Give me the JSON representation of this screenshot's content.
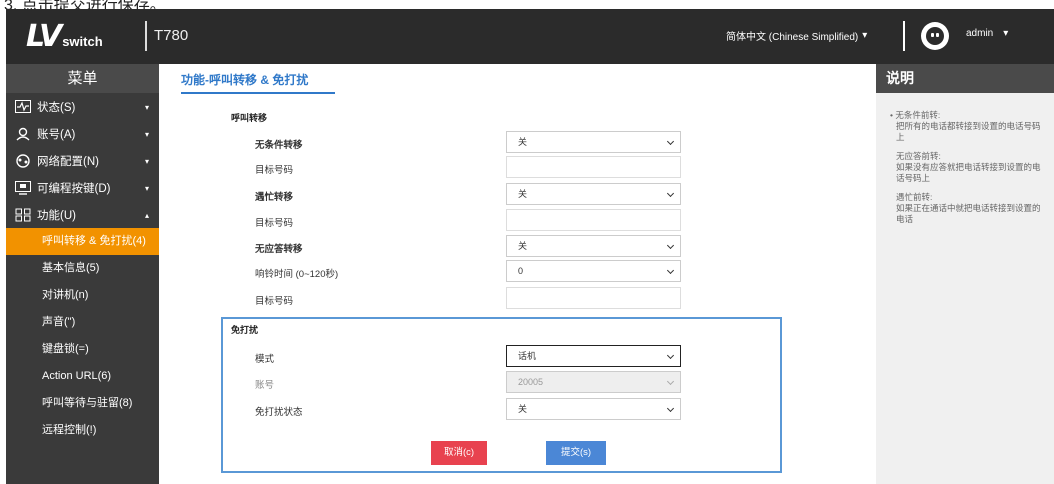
{
  "caption": "3. 点击提交进行保存。",
  "topbar": {
    "logo_mark": "LV",
    "logo_sub": "switch",
    "model": "T780",
    "language": "简体中文 (Chinese Simplified)",
    "language_caret": "▾",
    "user": "admin",
    "user_caret": "▾"
  },
  "sidebar": {
    "title": "菜单",
    "items": [
      {
        "label": "状态(S)",
        "icon": "status-icon",
        "caret": "▾"
      },
      {
        "label": "账号(A)",
        "icon": "account-icon",
        "caret": "▾"
      },
      {
        "label": "网络配置(N)",
        "icon": "network-icon",
        "caret": "▾"
      },
      {
        "label": "可编程按键(D)",
        "icon": "keys-icon",
        "caret": "▾"
      },
      {
        "label": "功能(U)",
        "icon": "features-icon",
        "caret": "▴"
      }
    ],
    "subitems": [
      {
        "label": "呼叫转移 & 免打扰(4)",
        "active": true
      },
      {
        "label": "基本信息(5)",
        "active": false
      },
      {
        "label": "对讲机(n)",
        "active": false
      },
      {
        "label": "声音(\")",
        "active": false
      },
      {
        "label": "键盘锁(=)",
        "active": false
      },
      {
        "label": "Action URL(6)",
        "active": false
      },
      {
        "label": "呼叫等待与驻留(8)",
        "active": false
      },
      {
        "label": "远程控制(!)",
        "active": false
      }
    ],
    "accent": "#f29200"
  },
  "main": {
    "title": "功能-呼叫转移 & 免打扰",
    "forward_section": "呼叫转移",
    "unconditional_label": "无条件转移",
    "unconditional_value": "关",
    "target1_label": "目标号码",
    "target1_value": "",
    "busy_label": "遇忙转移",
    "busy_value": "关",
    "target2_label": "目标号码",
    "target2_value": "",
    "noanswer_label": "无应答转移",
    "noanswer_value": "关",
    "ring_time_label": "响铃时间 (0~120秒)",
    "ring_time_value": "0",
    "target3_label": "目标号码",
    "target3_value": "",
    "dnd_section": "免打扰",
    "mode_label": "模式",
    "mode_value": "话机",
    "account_label": "账号",
    "account_value": "20005",
    "dnd_status_label": "免打扰状态",
    "dnd_status_value": "关",
    "cancel_label": "取消(c)",
    "submit_label": "提交(s)",
    "accent": "#3079c9"
  },
  "help": {
    "title": "说明",
    "entries": [
      {
        "head": "无条件前转:",
        "body": "把所有的电话都转接到设置的电话号码上"
      },
      {
        "head": "无应答前转:",
        "body": "如果没有应答就把电话转接到设置的电话号码上"
      },
      {
        "head": "遇忙前转:",
        "body": "如果正在通话中就把电话转接到设置的电话"
      }
    ]
  }
}
